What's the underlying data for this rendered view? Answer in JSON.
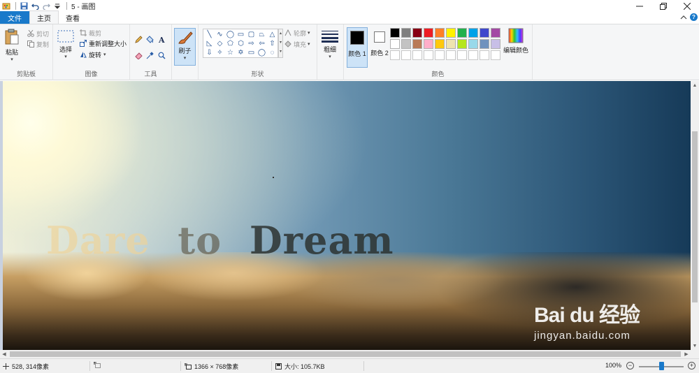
{
  "app": {
    "title": "5 - 画图",
    "quick_access": [
      "app-menu-icon",
      "save-icon",
      "undo-icon",
      "redo-icon",
      "customize-quick-access-icon"
    ]
  },
  "tabs": [
    {
      "label": "文件",
      "active": false
    },
    {
      "label": "主页",
      "active": true
    },
    {
      "label": "查看",
      "active": false
    }
  ],
  "ribbon": {
    "clipboard": {
      "group_label": "剪贴板",
      "paste": "粘贴",
      "cut": "剪切",
      "copy": "复制"
    },
    "image": {
      "group_label": "图像",
      "select": "选择",
      "crop": "裁剪",
      "resize": "重新调整大小",
      "rotate": "旋转"
    },
    "tools": {
      "group_label": "工具"
    },
    "brushes": {
      "label": "刷子"
    },
    "shapes": {
      "group_label": "形状",
      "outline": "轮廓",
      "fill": "填充"
    },
    "size": {
      "label": "粗细"
    },
    "colors": {
      "group_label": "颜色",
      "color1_label": "颜色 1",
      "color2_label": "颜色 2",
      "edit_colors": "编辑颜色",
      "color1": "#000000",
      "color2": "#ffffff",
      "palette_row1": [
        "#000000",
        "#7f7f7f",
        "#880015",
        "#ed1c24",
        "#ff7f27",
        "#fff200",
        "#22b14c",
        "#00a2e8",
        "#3f48cc",
        "#a349a4"
      ],
      "palette_row2": [
        "#ffffff",
        "#c3c3c3",
        "#b97a57",
        "#ffaec9",
        "#ffc90e",
        "#efe4b0",
        "#b5e61d",
        "#99d9ea",
        "#7092be",
        "#c8bfe7"
      ]
    }
  },
  "canvas": {
    "text": "Dare  to  Dream",
    "watermark_logo": "Bai du 经验",
    "watermark_url": "jingyan.baidu.com"
  },
  "status": {
    "cursor": "528, 314像素",
    "image_size": "1366 × 768像素",
    "file_size": "大小: 105.7KB",
    "zoom": "100%",
    "zoom_level": 0.5
  }
}
